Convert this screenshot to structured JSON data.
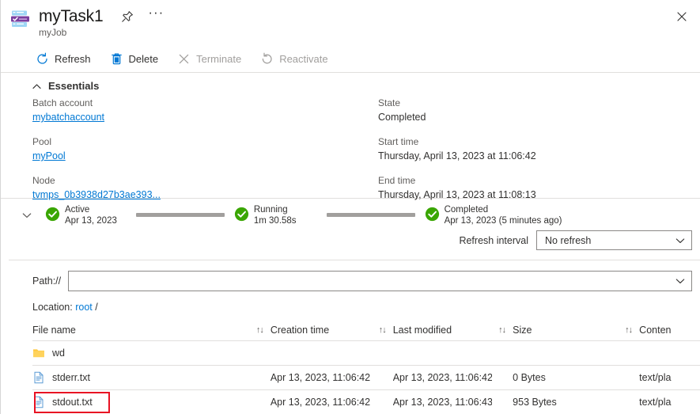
{
  "header": {
    "icon": "batch-task-icon",
    "title": "myTask1",
    "subtitle": "myJob",
    "pin_icon": "pin-icon",
    "more_icon": "ellipsis-icon",
    "close_icon": "close-icon"
  },
  "toolbar": {
    "items": [
      {
        "label": "Refresh",
        "icon": "refresh-icon",
        "disabled": false
      },
      {
        "label": "Delete",
        "icon": "trash-icon",
        "disabled": false
      },
      {
        "label": "Terminate",
        "icon": "x-icon",
        "disabled": true
      },
      {
        "label": "Reactivate",
        "icon": "reactivate-icon",
        "disabled": true
      }
    ]
  },
  "essentials": {
    "title": "Essentials",
    "collapse_icon": "chevron-up-icon",
    "left": [
      {
        "label": "Batch account",
        "value": "mybatchaccount",
        "link": true
      },
      {
        "label": "Pool",
        "value": "myPool",
        "link": true
      },
      {
        "label": "Node",
        "value": "tvmps_0b3938d27b3ae393...",
        "link": true
      }
    ],
    "right": [
      {
        "label": "State",
        "value": "Completed",
        "link": false
      },
      {
        "label": "Start time",
        "value": "Thursday, April 13, 2023 at 11:06:42",
        "link": false
      },
      {
        "label": "End time",
        "value": "Thursday, April 13, 2023 at 11:08:13",
        "link": false
      }
    ]
  },
  "timeline": {
    "expand_icon": "chevron-down-icon",
    "steps": [
      {
        "name": "Active",
        "detail": "Apr 13, 2023",
        "icon": "check-circle-icon"
      },
      {
        "name": "Running",
        "detail": "1m 30.58s",
        "icon": "check-circle-icon"
      },
      {
        "name": "Completed",
        "detail": "Apr 13, 2023 (5 minutes ago)",
        "icon": "check-circle-icon"
      }
    ]
  },
  "refresh": {
    "label": "Refresh interval",
    "selected": "No refresh",
    "chevron_icon": "chevron-down-icon"
  },
  "path": {
    "label": "Path://",
    "value": "",
    "placeholder": "",
    "chevron_icon": "chevron-down-icon"
  },
  "location": {
    "prefix": "Location:",
    "link": "root",
    "suffix": "/"
  },
  "files_table": {
    "sort_icon": "sort-arrows-icon",
    "columns": [
      {
        "label": "File name",
        "sortable": true
      },
      {
        "label": "Creation time",
        "sortable": true
      },
      {
        "label": "Last modified",
        "sortable": true
      },
      {
        "label": "Size",
        "sortable": true
      },
      {
        "label": "Conten",
        "sortable": false
      }
    ],
    "rows": [
      {
        "icon": "folder-icon",
        "name": "wd",
        "creation_time": "",
        "last_modified": "",
        "size": "",
        "content_type": "",
        "highlighted": false
      },
      {
        "icon": "file-icon",
        "name": "stderr.txt",
        "creation_time": "Apr 13, 2023, 11:06:42",
        "last_modified": "Apr 13, 2023, 11:06:42",
        "size": "0 Bytes",
        "content_type": "text/pla",
        "highlighted": false
      },
      {
        "icon": "file-icon",
        "name": "stdout.txt",
        "creation_time": "Apr 13, 2023, 11:06:42",
        "last_modified": "Apr 13, 2023, 11:06:43",
        "size": "953 Bytes",
        "content_type": "text/pla",
        "highlighted": true
      }
    ]
  },
  "colors": {
    "link": "#0078d4",
    "success": "#3aa603",
    "highlight": "#e81123",
    "folder": "#ffc83d",
    "disabled_text": "#a19f9d"
  }
}
